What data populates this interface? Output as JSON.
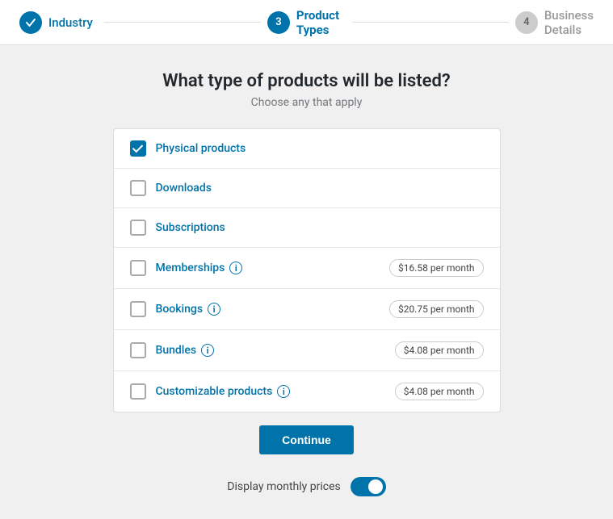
{
  "stepper": {
    "steps": [
      {
        "id": "industry",
        "label": "Industry",
        "number": "✓",
        "state": "done"
      },
      {
        "id": "product-types",
        "label": "Product Types",
        "number": "3",
        "state": "active"
      },
      {
        "id": "business-details",
        "label": "Business Details",
        "number": "4",
        "state": "inactive"
      }
    ]
  },
  "page": {
    "title": "What type of products will be listed?",
    "subtitle": "Choose any that apply"
  },
  "products": [
    {
      "id": "physical",
      "label": "Physical products",
      "checked": true,
      "has_info": false,
      "price": null
    },
    {
      "id": "downloads",
      "label": "Downloads",
      "checked": false,
      "has_info": false,
      "price": null
    },
    {
      "id": "subscriptions",
      "label": "Subscriptions",
      "checked": false,
      "has_info": false,
      "price": null
    },
    {
      "id": "memberships",
      "label": "Memberships",
      "checked": false,
      "has_info": true,
      "price": "$16.58 per month"
    },
    {
      "id": "bookings",
      "label": "Bookings",
      "checked": false,
      "has_info": true,
      "price": "$20.75 per month"
    },
    {
      "id": "bundles",
      "label": "Bundles",
      "checked": false,
      "has_info": true,
      "price": "$4.08 per month"
    },
    {
      "id": "customizable",
      "label": "Customizable products",
      "checked": false,
      "has_info": true,
      "price": "$4.08 per month"
    }
  ],
  "continue_button": "Continue",
  "footer": {
    "toggle_label": "Display monthly prices",
    "toggle_on": true
  }
}
